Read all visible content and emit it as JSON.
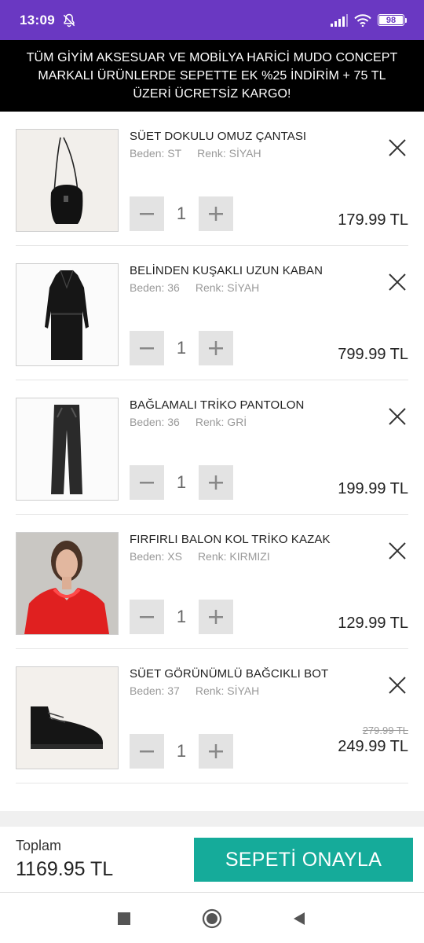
{
  "status": {
    "time": "13:09",
    "battery": "98"
  },
  "promo": {
    "text": "TÜM GİYİM AKSESUAR VE MOBİLYA HARİCİ MUDO CONCEPT MARKALI ÜRÜNLERDE SEPETTE EK %25 İNDİRİM + 75 TL ÜZERİ ÜCRETSİZ KARGO!"
  },
  "items": [
    {
      "name": "SÜET DOKULU OMUZ ÇANTASI",
      "size": "Beden: ST",
      "color": "Renk: SİYAH",
      "qty": "1",
      "price": "179.99 TL"
    },
    {
      "name": "BELİNDEN KUŞAKLI UZUN KABAN",
      "size": "Beden: 36",
      "color": "Renk: SİYAH",
      "qty": "1",
      "price": "799.99 TL"
    },
    {
      "name": "BAĞLAMALI TRİKO PANTOLON",
      "size": "Beden: 36",
      "color": "Renk: GRİ",
      "qty": "1",
      "price": "199.99 TL"
    },
    {
      "name": "FIRFIRLI BALON KOL TRİKO KAZAK",
      "size": "Beden: XS",
      "color": "Renk: KIRMIZI",
      "qty": "1",
      "price": "129.99 TL"
    },
    {
      "name": "SÜET GÖRÜNÜMLÜ BAĞCIKLI BOT",
      "size": "Beden: 37",
      "color": "Renk: SİYAH",
      "qty": "1",
      "old_price": "279.99 TL",
      "price": "249.99 TL"
    }
  ],
  "footer": {
    "total_label": "Toplam",
    "total_value": "1169.95 TL",
    "confirm_label": "SEPETİ ONAYLA"
  },
  "colors": {
    "status_bar": "#6a38c2",
    "confirm": "#15ab9a",
    "banner": "#000000"
  },
  "icons": {
    "remove": "close-icon",
    "decrement": "minus-icon",
    "increment": "plus-icon"
  }
}
